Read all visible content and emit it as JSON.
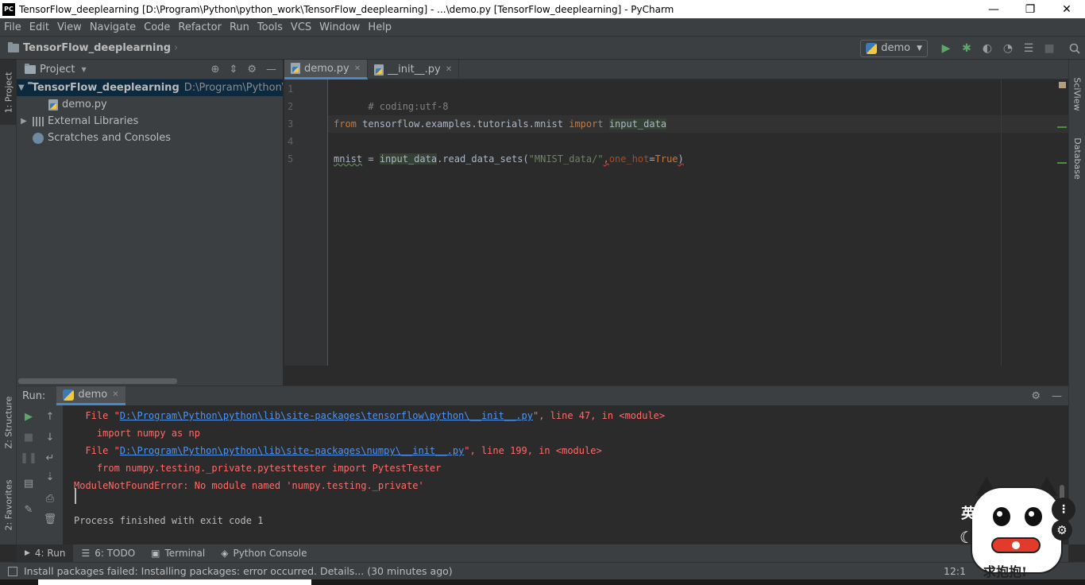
{
  "window": {
    "title": "TensorFlow_deeplearning [D:\\Program\\Python\\python_work\\TensorFlow_deeplearning] - ...\\demo.py [TensorFlow_deeplearning] - PyCharm",
    "logo_text": "PC",
    "minimize": "—",
    "restore": "❐",
    "close": "✕"
  },
  "menu": [
    "File",
    "Edit",
    "View",
    "Navigate",
    "Code",
    "Refactor",
    "Run",
    "Tools",
    "VCS",
    "Window",
    "Help"
  ],
  "navbar": {
    "project_crumb": "TensorFlow_deeplearning",
    "crumb_sep": "›",
    "run_config": "demo",
    "run_config_arrow": "▼"
  },
  "left_stripe": {
    "project_tab": "1: Project",
    "structure_tab": "Z: Structure",
    "favorites_tab": "2: Favorites"
  },
  "right_stripe": {
    "sciview_tab": "SciView",
    "database_tab": "Database"
  },
  "project_panel": {
    "title": "Project",
    "title_arrow": "▼",
    "tree": {
      "root_name": "TensorFlow_deeplearning",
      "root_path": "D:\\Program\\Python\\py",
      "file_demo": "demo.py",
      "external_libraries": "External Libraries",
      "scratches": "Scratches and Consoles"
    }
  },
  "editor": {
    "tabs": [
      {
        "label": "demo.py",
        "close": "✕"
      },
      {
        "label": "__init__.py",
        "close": "✕"
      }
    ],
    "line_numbers": [
      "1",
      "2",
      "3",
      "4",
      "5"
    ],
    "code": {
      "line1": "# coding:utf-8",
      "line3_from": "from",
      "line3_module": " tensorflow.examples.tutorials.mnist ",
      "line3_import": "import",
      "line3_space": " ",
      "line3_name": "input_data",
      "line5_var": "mnist",
      "line5_eq": " = ",
      "line5_obj": "input_data",
      "line5_call": ".read_data_sets(",
      "line5_str": "\"MNIST_data/\"",
      "line5_comma": ",",
      "line5_param": "one_hot",
      "line5_eqv": "=",
      "line5_true": "True",
      "line5_close": ")"
    }
  },
  "run_panel": {
    "label": "Run:",
    "tab_label": "demo",
    "tab_close": "✕",
    "console": {
      "l1_pre": "  File \"",
      "l1_link": "D:\\Program\\Python\\python\\lib\\site-packages\\tensorflow\\python\\__init__.py",
      "l1_post": "\", line 47, in <module>",
      "l2": "    import numpy as np",
      "l3_pre": "  File \"",
      "l3_link": "D:\\Program\\Python\\python\\lib\\site-packages\\numpy\\__init__.py",
      "l3_post": "\", line 199, in <module>",
      "l4": "    from numpy.testing._private.pytesttester import PytestTester",
      "l5": "ModuleNotFoundError: No module named 'numpy.testing._private'",
      "l7": "Process finished with exit code 1"
    }
  },
  "bottom_tabs": [
    {
      "label": "4: Run",
      "icon": "▶"
    },
    {
      "label": "6: TODO",
      "icon": "☰"
    },
    {
      "label": "Terminal",
      "icon": "▣"
    },
    {
      "label": "Python Console",
      "icon": "◈"
    }
  ],
  "status": {
    "message": "Install packages failed: Installing packages: error occurred. Details... (30 minutes ago)",
    "position": "12:1"
  },
  "sticker": {
    "caption": "求抱抱!",
    "side_char": "英",
    "moon": "☾",
    "dots": "⋮",
    "gear": "⚙"
  },
  "colors": {
    "accent": "#4a88c7",
    "error": "#ff6b68",
    "link": "#5394ec",
    "run_green": "#59a869"
  }
}
